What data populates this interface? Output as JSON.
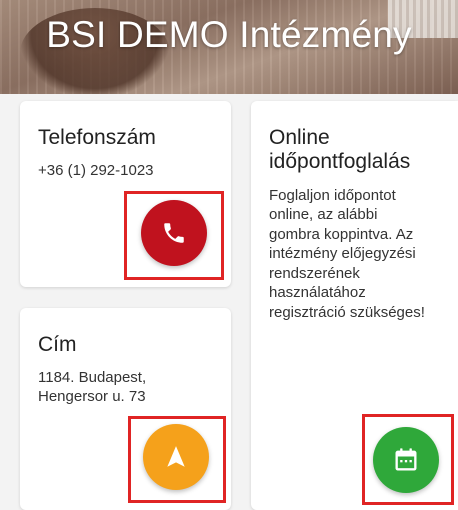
{
  "banner": {
    "title": "BSI DEMO Intézmény"
  },
  "phone_card": {
    "title": "Telefonszám",
    "value": "+36 (1) 292-1023",
    "button_icon": "phone-icon",
    "button_color": "#c0121e"
  },
  "address_card": {
    "title": "Cím",
    "line1": "1184. Budapest,",
    "line2": "Hengersor u. 73",
    "button_icon": "navigation-arrow-icon",
    "button_color": "#f5a11b"
  },
  "booking_card": {
    "title_line1": "Online",
    "title_line2": "időpontfoglalás",
    "description_lines": [
      "Foglaljon időpontot",
      "online, az alábbi",
      "gombra koppintva. Az",
      "intézmény előjegyzési",
      "rendszerének",
      "használatához",
      "regisztráció szükséges!"
    ],
    "button_icon": "calendar-icon",
    "button_color": "#2fa83a"
  },
  "colors": {
    "highlight": "#e02424"
  }
}
